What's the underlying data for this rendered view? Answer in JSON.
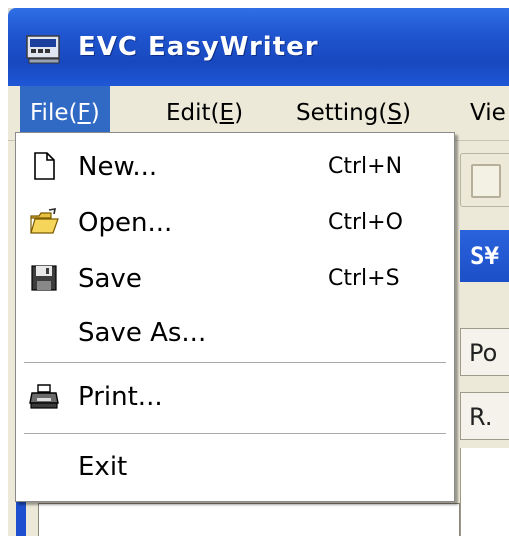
{
  "window": {
    "title": "EVC EasyWriter",
    "app_icon": "app-icon"
  },
  "menubar": {
    "items": [
      {
        "label": "File(",
        "mnemonic": "F",
        "suffix": ")"
      },
      {
        "label": "Edit(",
        "mnemonic": "E",
        "suffix": ")"
      },
      {
        "label": "Setting(",
        "mnemonic": "S",
        "suffix": ")"
      },
      {
        "label": "Vie"
      }
    ]
  },
  "file_menu": {
    "items": [
      {
        "label": "New...",
        "shortcut": "Ctrl+N",
        "icon": "new-file-icon"
      },
      {
        "label": "Open...",
        "shortcut": "Ctrl+O",
        "icon": "open-folder-icon"
      },
      {
        "label": "Save",
        "shortcut": "Ctrl+S",
        "icon": "save-icon"
      },
      {
        "label": "Save As...",
        "shortcut": ""
      },
      {
        "label": "Print...",
        "shortcut": "",
        "icon": "printer-icon"
      },
      {
        "label": "Exit",
        "shortcut": ""
      }
    ]
  },
  "background": {
    "panel_title": "S¥",
    "field_1": "Po",
    "field_2": "R.",
    "toolbar_icon": "paste-icon"
  },
  "colors": {
    "title_bar": "#1f55cf",
    "menu_highlight": "#316ac5",
    "menu_bg": "#ece9d8"
  }
}
